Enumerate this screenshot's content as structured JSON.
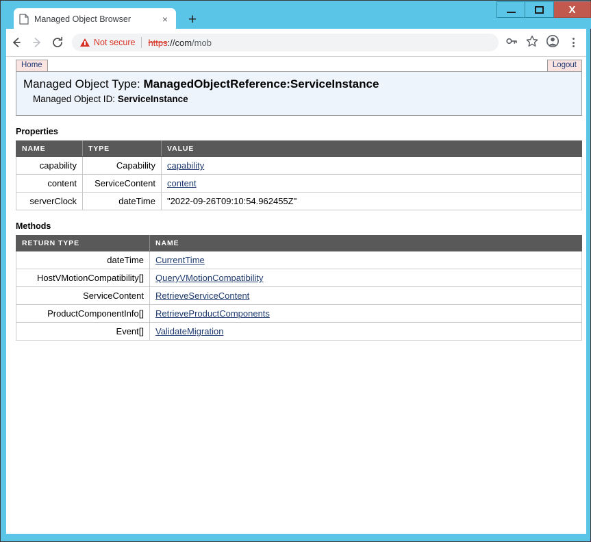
{
  "window": {
    "controls": {
      "minimize": "−",
      "maximize": "□",
      "close": "X"
    }
  },
  "browser": {
    "tab": {
      "title": "Managed Object Browser",
      "favicon": "page-icon",
      "close": "×"
    },
    "new_tab": "+",
    "nav": {
      "back": "back-arrow-icon",
      "forward": "forward-arrow-icon",
      "reload": "reload-icon"
    },
    "omnibox": {
      "security_label": "Not secure",
      "url_scheme": "https",
      "url_host": "://com",
      "url_path": "/mob"
    },
    "toolbar_icons": {
      "password": "key-icon",
      "bookmark": "star-icon",
      "profile": "account-avatar-icon",
      "menu": "three-dot-menu-icon"
    }
  },
  "mob": {
    "tabs": {
      "home": "Home",
      "logout": "Logout"
    },
    "header": {
      "type_label": "Managed Object Type:",
      "type_value": "ManagedObjectReference:ServiceInstance",
      "id_label": "Managed Object ID:",
      "id_value": "ServiceInstance"
    },
    "properties": {
      "title": "Properties",
      "columns": [
        "NAME",
        "TYPE",
        "VALUE"
      ],
      "rows": [
        {
          "name": "capability",
          "type": "Capability",
          "value": "capability",
          "is_link": true
        },
        {
          "name": "content",
          "type": "ServiceContent",
          "value": "content",
          "is_link": true
        },
        {
          "name": "serverClock",
          "type": "dateTime",
          "value": "\"2022-09-26T09:10:54.962455Z\"",
          "is_link": false
        }
      ]
    },
    "methods": {
      "title": "Methods",
      "columns": [
        "RETURN TYPE",
        "NAME"
      ],
      "rows": [
        {
          "return_type": "dateTime",
          "name": "CurrentTime"
        },
        {
          "return_type": "HostVMotionCompatibility[]",
          "name": "QueryVMotionCompatibility"
        },
        {
          "return_type": "ServiceContent",
          "name": "RetrieveServiceContent"
        },
        {
          "return_type": "ProductComponentInfo[]",
          "name": "RetrieveProductComponents"
        },
        {
          "return_type": "Event[]",
          "name": "ValidateMigration"
        }
      ]
    }
  },
  "colors": {
    "titlebar": "#5BC5E8",
    "close_button": "#c1594f",
    "table_header": "#595959",
    "link": "#1e3a6e",
    "panel_bg": "#eef4fb",
    "tab_bg": "#f9e4e2",
    "warning": "#d93025"
  }
}
